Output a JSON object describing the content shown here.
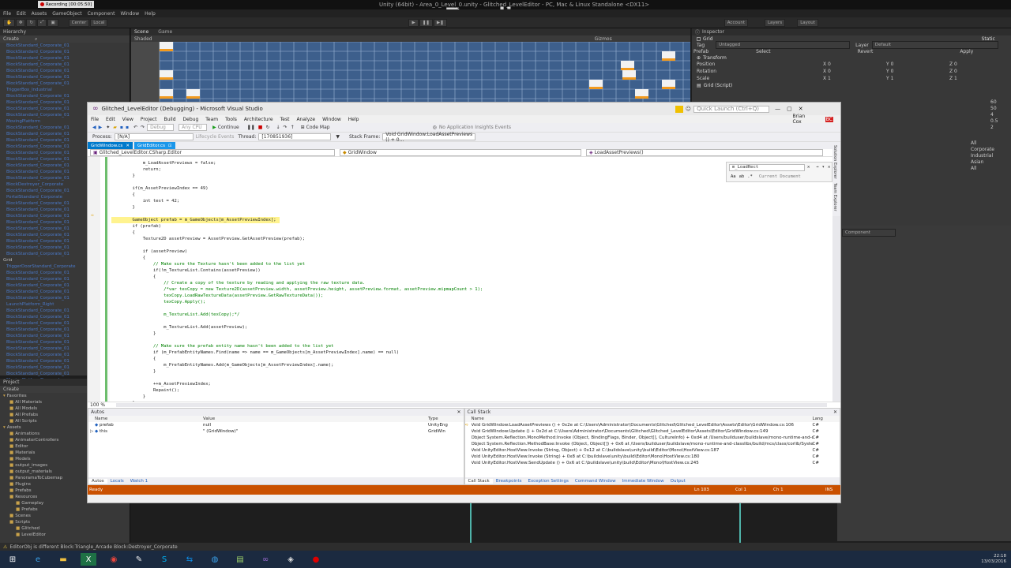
{
  "unity": {
    "title": "Unity (64bit) - Area_0_Level_0.unity - Glitched_LevelEditor - PC, Mac & Linux Standalone <DX11>",
    "recording": "Recording [00:05:50]",
    "menu": [
      "File",
      "Edit",
      "Assets",
      "GameObject",
      "Component",
      "Window",
      "Help"
    ],
    "toolbar": {
      "center": "Center",
      "local": "Local",
      "account": "Account",
      "layers": "Layers",
      "layout": "Layout"
    },
    "hierarchy_tab": "Hierarchy",
    "hierarchy_create": "Create",
    "hierarchy_items": [
      "BlockStandard_Corporate_01",
      "BlockStandard_Corporate_01",
      "BlockStandard_Corporate_01",
      "BlockStandard_Corporate_01",
      "BlockStandard_Corporate_01",
      "BlockStandard_Corporate_01",
      "BlockStandard_Corporate_01",
      "TriggerBox_Industrial",
      "BlockStandard_Corporate_01",
      "BlockStandard_Corporate_01",
      "BlockStandard_Corporate_01",
      "BlockStandard_Corporate_01",
      "MovingPlatform",
      "BlockStandard_Corporate_01",
      "BlockStandard_Corporate_01",
      "BlockStandard_Corporate_01",
      "BlockStandard_Corporate_01",
      "BlockStandard_Corporate_01",
      "BlockStandard_Corporate_01",
      "BlockStandard_Corporate_01",
      "BlockStandard_Corporate_01",
      "BlockStandard_Corporate_01",
      "BlockDestroyer_Corporate",
      "BlockStandard_Corporate_01",
      "PortalStandard_Corporate",
      "BlockStandard_Corporate_01",
      "BlockStandard_Corporate_01",
      "BlockStandard_Corporate_01",
      "BlockStandard_Corporate_01",
      "BlockStandard_Corporate_01",
      "BlockStandard_Corporate_01",
      "BlockStandard_Corporate_01",
      "BlockStandard_Corporate_01",
      "BlockStandard_Corporate_01",
      "Grid",
      "TriggerDoorStandard_Corporate",
      "BlockStandard_Corporate_01",
      "BlockStandard_Corporate_01",
      "BlockStandard_Corporate_01",
      "BlockStandard_Corporate_01",
      "BlockStandard_Corporate_01",
      "LaunchPlatform_Right",
      "BlockStandard_Corporate_01",
      "BlockStandard_Corporate_01",
      "BlockStandard_Corporate_01",
      "BlockStandard_Corporate_01",
      "BlockStandard_Corporate_01",
      "BlockStandard_Corporate_01",
      "BlockStandard_Corporate_01",
      "BlockStandard_Corporate_01",
      "BlockStandard_Corporate_01",
      "BlockStandard_Corporate_01",
      "BlockStandard_Corporate_01",
      "MovingPlatformDescender"
    ],
    "project_tab": "Project",
    "project_create": "Create",
    "project_items": [
      {
        "label": "Favorites",
        "indent": 0
      },
      {
        "label": "All Materials",
        "indent": 1
      },
      {
        "label": "All Models",
        "indent": 1
      },
      {
        "label": "All Prefabs",
        "indent": 1
      },
      {
        "label": "All Scripts",
        "indent": 1
      },
      {
        "label": "Assets",
        "indent": 0
      },
      {
        "label": "Animations",
        "indent": 1
      },
      {
        "label": "AnimatorControllers",
        "indent": 1
      },
      {
        "label": "Editor",
        "indent": 1
      },
      {
        "label": "Materials",
        "indent": 1
      },
      {
        "label": "Models",
        "indent": 1
      },
      {
        "label": "output_images",
        "indent": 1
      },
      {
        "label": "output_materials",
        "indent": 1
      },
      {
        "label": "PanoramaToCubemap",
        "indent": 1
      },
      {
        "label": "Plugins",
        "indent": 1
      },
      {
        "label": "Prefabs",
        "indent": 1
      },
      {
        "label": "Resources",
        "indent": 1
      },
      {
        "label": "Gameplay",
        "indent": 2
      },
      {
        "label": "Prefabs",
        "indent": 2
      },
      {
        "label": "Scenes",
        "indent": 1
      },
      {
        "label": "Scripts",
        "indent": 1
      },
      {
        "label": "Glitched",
        "indent": 2
      },
      {
        "label": "LevelEditor",
        "indent": 2
      }
    ],
    "scene_tab": "Scene",
    "game_tab": "Game",
    "shaded": "Shaded",
    "gizmos": "Gizmos",
    "inspector": {
      "tab": "Inspector",
      "object_name": "Grid",
      "static": "Static",
      "tag_label": "Tag",
      "tag_value": "Untagged",
      "layer_label": "Layer",
      "layer_value": "Default",
      "prefab_label": "Prefab",
      "select": "Select",
      "revert": "Revert",
      "apply": "Apply",
      "transform": "Transform",
      "position": "Position",
      "rotation": "Rotation",
      "scale": "Scale",
      "pos": [
        "0",
        "0",
        "0"
      ],
      "rot": [
        "0",
        "0",
        "0"
      ],
      "scl": [
        "1",
        "1",
        "1"
      ],
      "script_component": "Grid (Script)",
      "add_component": "Component",
      "side_numbers": [
        "60",
        "50",
        "4",
        "0.5",
        "2"
      ],
      "side_labels": [
        "All",
        "Corporate",
        "Industrial",
        "Asian",
        "All"
      ]
    },
    "status": "EditorObj is different Block:Triangle_Arcade Block:Destroyer_Corporate",
    "clock": {
      "time": "22:18",
      "date": "13/03/2016"
    }
  },
  "watermark": "www.Bandicam.com",
  "vs": {
    "title": "Glitched_LevelEditor (Debugging) - Microsoft Visual Studio",
    "quick_launch": "Quick Launch (Ctrl+Q)",
    "user": "Brian Cox",
    "user_initials": "BC",
    "menu": [
      "File",
      "Edit",
      "View",
      "Project",
      "Build",
      "Debug",
      "Team",
      "Tools",
      "Architecture",
      "Test",
      "Analyze",
      "Window",
      "Help"
    ],
    "toolbar": {
      "config": "Debug",
      "platform": "Any CPU",
      "continue": "Continue",
      "code_map": "Code Map",
      "insights": "No Application Insights Events"
    },
    "toolbar2": {
      "process_label": "Process:",
      "process": "[N/A]",
      "lifecycle": "Lifecycle Events",
      "thread_label": "Thread:",
      "thread": "[170851936]",
      "stackframe_label": "Stack Frame:",
      "stackframe": "Void GridWindow:LoadAssetPreviews () + 0..."
    },
    "tabs": [
      "GridWindow.cs",
      "GridEditor.cs"
    ],
    "nav": {
      "project": "Glitched_LevelEditor.CSharp.Editor",
      "type": "GridWindow",
      "member": "LoadAssetPreviews()"
    },
    "find": {
      "query": "m_LoadRect",
      "scope": "Current Document"
    },
    "zoom": "100 %",
    "side_tabs": [
      "Solution Explorer",
      "Team Explorer"
    ],
    "code": [
      "            m_LoadAssetPreviews = false;",
      "            return;",
      "        }",
      "",
      "        if(m_AssetPreviewIndex == 49)",
      "        {",
      "            int test = 42;",
      "        }",
      "",
      "        GameObject prefab = m_GameObjects[m_AssetPreviewIndex];",
      "        if (prefab)",
      "        {",
      "            Texture2D assetPreview = AssetPreview.GetAssetPreview(prefab);",
      "",
      "            if (assetPreview)",
      "            {",
      "                // Make sure the Texture hasn't been added to the list yet",
      "                if(!m_TextureList.Contains(assetPreview))",
      "                {",
      "                    // Create a copy of the texture by reading and applying the raw texture data.",
      "                    /*var texCopy = new Texture2D(assetPreview.width, assetPreview.height, assetPreview.format, assetPreview.mipmapCount > 1);",
      "                    texCopy.LoadRawTextureData(assetPreview.GetRawTextureData());",
      "                    texCopy.Apply();",
      "",
      "                    m_TextureList.Add(texCopy);*/",
      "",
      "                    m_TextureList.Add(assetPreview);",
      "                }",
      "",
      "                // Make sure the prefab entity name hasn't been added to the list yet",
      "                if (m_PrefabEntityNames.Find(name => name == m_GameObjects[m_AssetPreviewIndex].name) == null)",
      "                {",
      "                    m_PrefabEntityNames.Add(m_GameObjects[m_AssetPreviewIndex].name);",
      "                }",
      "",
      "                ++m_AssetPreviewIndex;",
      "                Repaint();",
      "            }",
      "        }"
    ],
    "autos": {
      "title": "Autos",
      "cols": [
        "Name",
        "Value",
        "Type"
      ],
      "rows": [
        {
          "name": "prefab",
          "value": "null",
          "type": "UnityEng"
        },
        {
          "name": "this",
          "value": "\" (GridWindow)\"",
          "type": "GridWin"
        }
      ],
      "tabs": [
        "Autos",
        "Locals",
        "Watch 1"
      ]
    },
    "callstack": {
      "title": "Call Stack",
      "cols": [
        "Name",
        "Lang"
      ],
      "rows": [
        {
          "name": "Void GridWindow:LoadAssetPreviews () + 0x2e at C:\\Users\\Administrator\\Documents\\Glitched\\Glitched_LevelEditor\\Assets\\Editor\\GridWindow.cs:106",
          "lang": "C#"
        },
        {
          "name": "Void GridWindow:Update () + 0x2d at C:\\Users\\Administrator\\Documents\\Glitched\\Glitched_LevelEditor\\Assets\\Editor\\GridWindow.cs:149",
          "lang": "C#"
        },
        {
          "name": "Object System.Reflection.MonoMethod:Invoke (Object, BindingFlags, Binder, Object[], CultureInfo) + 0xd4 at /Users/builduser/buildslave/mono-runtime-and-classlib",
          "lang": "C#"
        },
        {
          "name": "Object System.Reflection.MethodBase:Invoke (Object, Object[]) + 0x6 at /Users/builduser/buildslave/mono-runtime-and-classlibs/build/mcs/class/corlib/System.Refl",
          "lang": "C#"
        },
        {
          "name": "Void UnityEditor.HostView:Invoke (String, Object) + 0x12 at C:\\buildslave\\unity\\build\\Editor\\Mono\\HostView.cs:187",
          "lang": "C#"
        },
        {
          "name": "Void UnityEditor.HostView:Invoke (String) + 0x8 at C:\\buildslave\\unity\\build\\Editor\\Mono\\HostView.cs:180",
          "lang": "C#"
        },
        {
          "name": "Void UnityEditor.HostView:SendUpdate () + 0x6 at C:\\buildslave\\unity\\build\\Editor\\Mono\\HostView.cs:245",
          "lang": "C#"
        }
      ],
      "tabs": [
        "Call Stack",
        "Breakpoints",
        "Exception Settings",
        "Command Window",
        "Immediate Window",
        "Output"
      ]
    },
    "status": {
      "ready": "Ready",
      "ln": "Ln 103",
      "col": "Col 1",
      "ch": "Ch 1",
      "ins": "INS"
    }
  }
}
